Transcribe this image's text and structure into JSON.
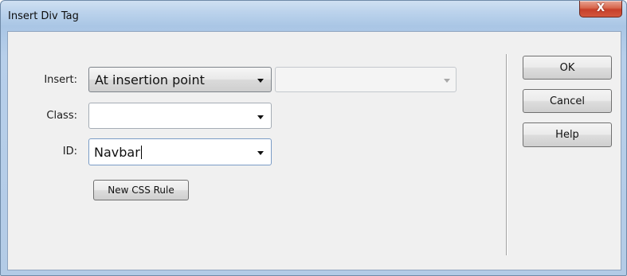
{
  "window": {
    "title": "Insert Div Tag",
    "close_glyph": "X"
  },
  "form": {
    "insert": {
      "label": "Insert:",
      "selected": "At insertion point",
      "secondary_selected": ""
    },
    "class": {
      "label": "Class:",
      "value": ""
    },
    "id": {
      "label": "ID:",
      "value": "Navbar"
    },
    "new_css_rule_label": "New CSS Rule"
  },
  "buttons": {
    "ok": "OK",
    "cancel": "Cancel",
    "help": "Help"
  },
  "colors": {
    "title_bar": "#bcd3ec",
    "client_bg": "#f0f0f0",
    "close_button": "#c7402a"
  },
  "icons": [
    "close-icon",
    "dropdown-arrow-icon"
  ]
}
